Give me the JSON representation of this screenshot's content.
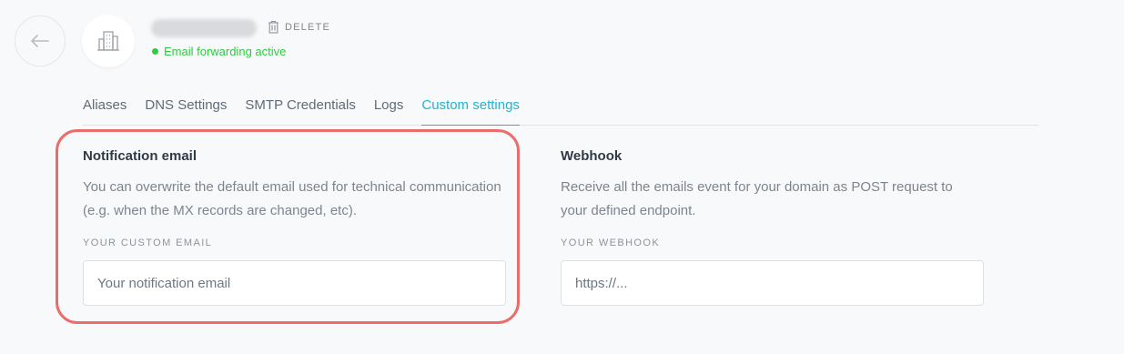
{
  "header": {
    "back_icon": "arrow-left-icon",
    "domain_icon": "building-icon",
    "domain_name": "domain-name",
    "delete_label": "DELETE",
    "delete_icon": "trash-icon",
    "status_text": "Email forwarding active",
    "status_color": "#2ecc40"
  },
  "tabs": [
    {
      "label": "Aliases",
      "active": false
    },
    {
      "label": "DNS Settings",
      "active": false
    },
    {
      "label": "SMTP Credentials",
      "active": false
    },
    {
      "label": "Logs",
      "active": false
    },
    {
      "label": "Custom settings",
      "active": true
    }
  ],
  "accent_color": "#1fb6d2",
  "highlight_color": "#ec6b6b",
  "notification": {
    "title": "Notification email",
    "description": "You can overwrite the default email used for technical communication (e.g. when the MX records are changed, etc).",
    "field_label": "YOUR CUSTOM EMAIL",
    "placeholder": "Your notification email",
    "value": ""
  },
  "webhook": {
    "title": "Webhook",
    "description": "Receive all the emails event for your domain as POST request to your defined endpoint.",
    "field_label": "YOUR WEBHOOK",
    "placeholder": "https://...",
    "value": ""
  }
}
